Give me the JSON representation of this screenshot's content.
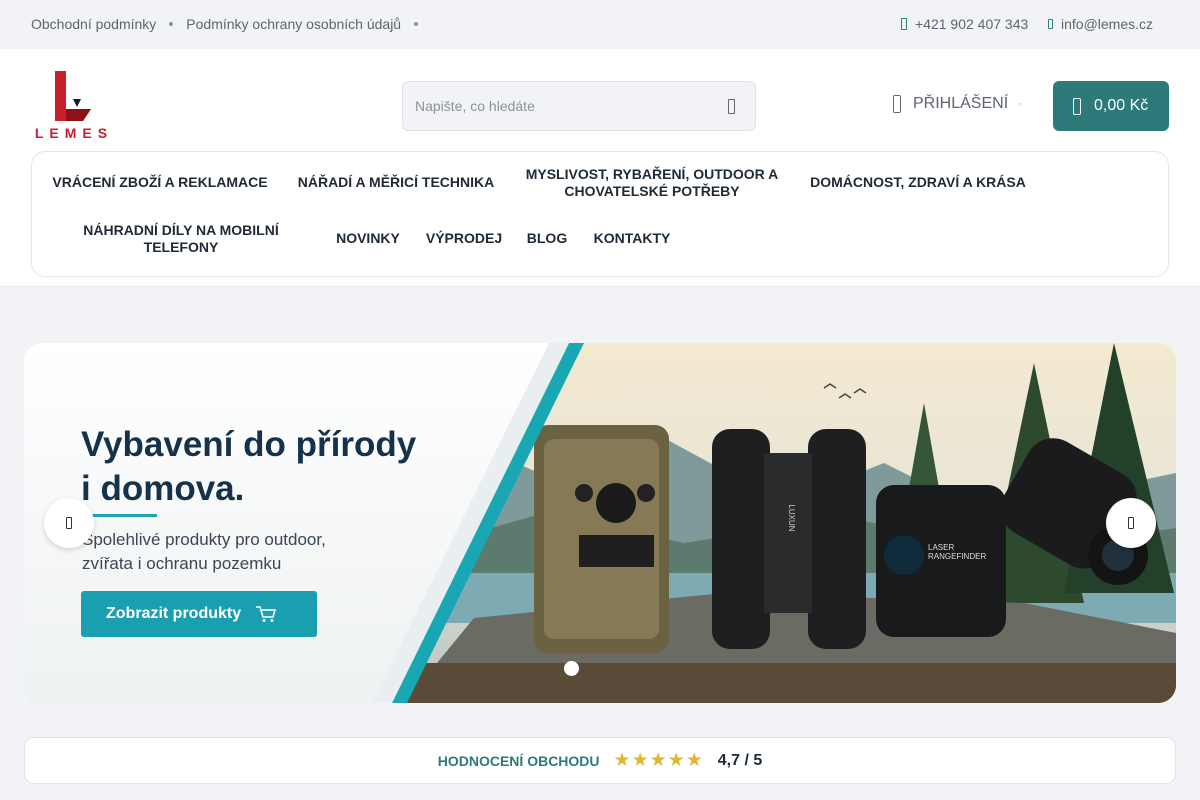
{
  "topbar": {
    "links": [
      "Obchodní podmínky",
      "Podmínky ochrany osobních údajů"
    ],
    "phone": "+421 902 407 343",
    "email": "info@lemes.cz"
  },
  "header": {
    "logo_text": "LEMES",
    "search_placeholder": "Napište, co hledáte",
    "login_label": "PŘIHLÁŠENÍ",
    "cart_total": "0,00 Kč"
  },
  "nav": {
    "items": [
      "VRÁCENÍ ZBOŽÍ A REKLAMACE",
      "NÁŘADÍ A MĚŘICÍ TECHNIKA",
      "MYSLIVOST, RYBAŘENÍ, OUTDOOR A CHOVATELSKÉ POTŘEBY",
      "DOMÁCNOST, ZDRAVÍ A KRÁSA",
      "NÁHRADNÍ DÍLY NA MOBILNÍ TELEFONY",
      "NOVINKY",
      "VÝPRODEJ",
      "BLOG",
      "KONTAKTY"
    ]
  },
  "banner": {
    "title_line1": "Vybavení do přírody",
    "title_line2": "i domova.",
    "subtitle_line1": "Spolehlivé produkty pro outdoor,",
    "subtitle_line2": "zvířata i ochranu pozemku",
    "cta_label": "Zobrazit produkty",
    "binocular_brand": "LUXUN",
    "rangefinder_label_line1": "LASER",
    "rangefinder_label_line2": "RANGEFINDER"
  },
  "rating": {
    "label": "HODNOCENÍ OBCHODU",
    "value": "4,7 / 5",
    "stars": 5
  },
  "colors": {
    "brand_teal": "#2d7a7a",
    "cta_teal": "#1a9fb0",
    "logo_red": "#c8202a",
    "star_gold": "#e0b830"
  }
}
